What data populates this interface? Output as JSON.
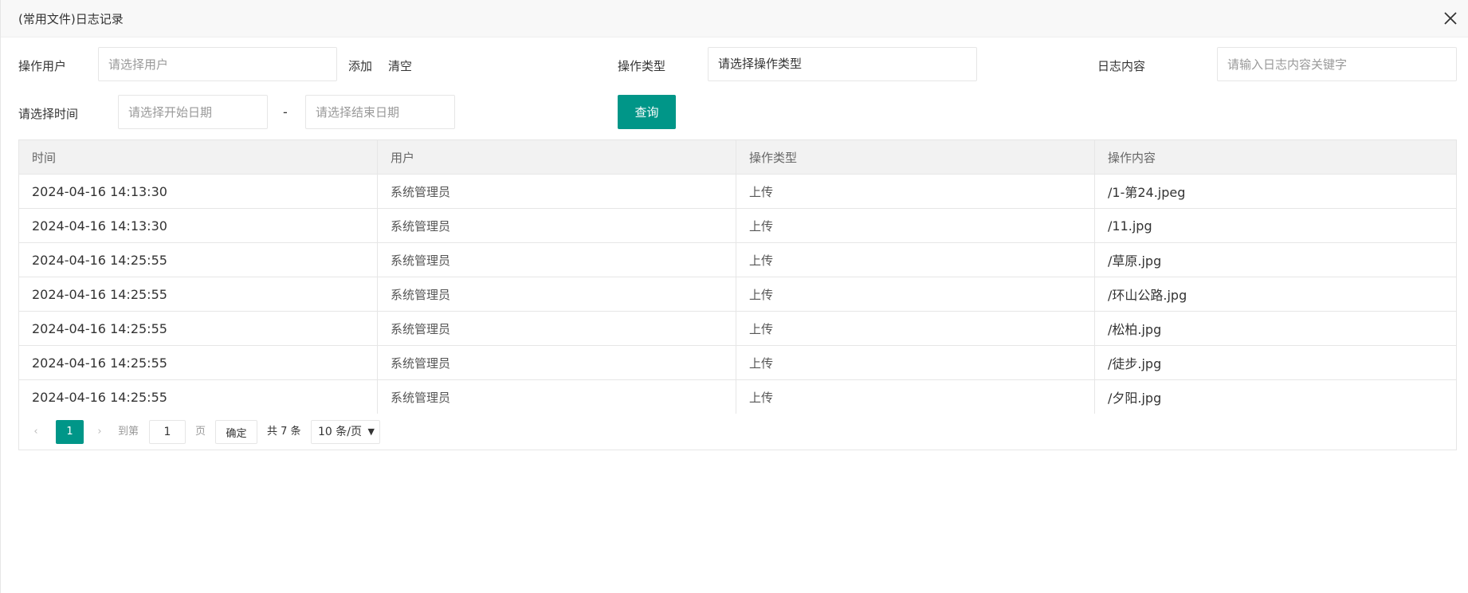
{
  "dialog": {
    "title": "(常用文件)日志记录"
  },
  "filters": {
    "user_label": "操作用户",
    "user_placeholder": "请选择用户",
    "add_label": "添加",
    "clear_label": "清空",
    "type_label": "操作类型",
    "type_value": "请选择操作类型",
    "content_label": "日志内容",
    "content_placeholder": "请输入日志内容关键字",
    "time_label": "请选择时间",
    "start_placeholder": "请选择开始日期",
    "range_sep": "-",
    "end_placeholder": "请选择结束日期",
    "query_label": "查询"
  },
  "table": {
    "headers": [
      "时间",
      "用户",
      "操作类型",
      "操作内容"
    ],
    "rows": [
      [
        "2024-04-16 14:13:30",
        "系统管理员",
        "上传",
        "/1-第24.jpeg"
      ],
      [
        "2024-04-16 14:13:30",
        "系统管理员",
        "上传",
        "/11.jpg"
      ],
      [
        "2024-04-16 14:25:55",
        "系统管理员",
        "上传",
        "/草原.jpg"
      ],
      [
        "2024-04-16 14:25:55",
        "系统管理员",
        "上传",
        "/环山公路.jpg"
      ],
      [
        "2024-04-16 14:25:55",
        "系统管理员",
        "上传",
        "/松柏.jpg"
      ],
      [
        "2024-04-16 14:25:55",
        "系统管理员",
        "上传",
        "/徒步.jpg"
      ],
      [
        "2024-04-16 14:25:55",
        "系统管理员",
        "上传",
        "/夕阳.jpg"
      ]
    ]
  },
  "pager": {
    "prev": "‹",
    "current": "1",
    "next": "›",
    "goto_label": "到第",
    "goto_value": "1",
    "unit": "页",
    "ok_label": "确定",
    "total": "共 7 条",
    "page_size": "10 条/页"
  },
  "colors": {
    "accent": "#009688",
    "header_bg": "#f2f2f2",
    "titlebar_bg": "#f8f8f8"
  }
}
